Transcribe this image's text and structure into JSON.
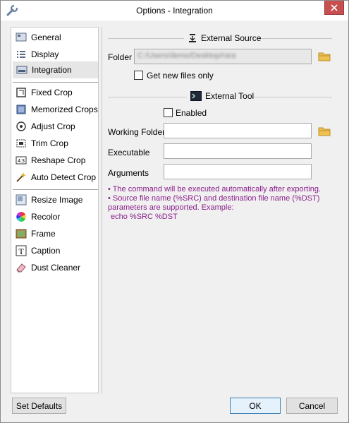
{
  "window": {
    "title": "Options - Integration"
  },
  "sidebar": {
    "items": [
      {
        "label": "General",
        "icon": "general-icon"
      },
      {
        "label": "Display",
        "icon": "display-icon"
      },
      {
        "label": "Integration",
        "icon": "integration-icon",
        "selected": true
      },
      {
        "label": "Fixed Crop",
        "icon": "fixed-crop-icon"
      },
      {
        "label": "Memorized Crops",
        "icon": "memorized-crops-icon"
      },
      {
        "label": "Adjust Crop",
        "icon": "adjust-crop-icon"
      },
      {
        "label": "Trim Crop",
        "icon": "trim-crop-icon"
      },
      {
        "label": "Reshape Crop",
        "icon": "reshape-crop-icon"
      },
      {
        "label": "Auto Detect Crop",
        "icon": "auto-detect-crop-icon"
      },
      {
        "label": "Resize Image",
        "icon": "resize-image-icon"
      },
      {
        "label": "Recolor",
        "icon": "recolor-icon"
      },
      {
        "label": "Frame",
        "icon": "frame-icon"
      },
      {
        "label": "Caption",
        "icon": "caption-icon"
      },
      {
        "label": "Dust Cleaner",
        "icon": "dust-cleaner-icon"
      }
    ]
  },
  "external_source": {
    "title": "External Source",
    "folder_label": "Folder",
    "folder_value": "C:/Users/demo/Desktop/rara",
    "get_new_files_label": "Get new files only",
    "get_new_files_checked": false
  },
  "external_tool": {
    "title": "External Tool",
    "enabled_label": "Enabled",
    "enabled_checked": false,
    "working_folder_label": "Working Folder",
    "working_folder_value": "",
    "executable_label": "Executable",
    "executable_value": "",
    "arguments_label": "Arguments",
    "arguments_value": "",
    "info_line1": "• The command will be executed automatically after exporting.",
    "info_line2": "• Source file name (%SRC) and destination file name (%DST)",
    "info_line3": "parameters are supported. Example:",
    "info_line4": "echo %SRC %DST"
  },
  "footer": {
    "set_defaults_label": "Set Defaults",
    "ok_label": "OK",
    "cancel_label": "Cancel"
  },
  "colors": {
    "info_text": "#8a1f8a",
    "close_button": "#c74f4f"
  }
}
